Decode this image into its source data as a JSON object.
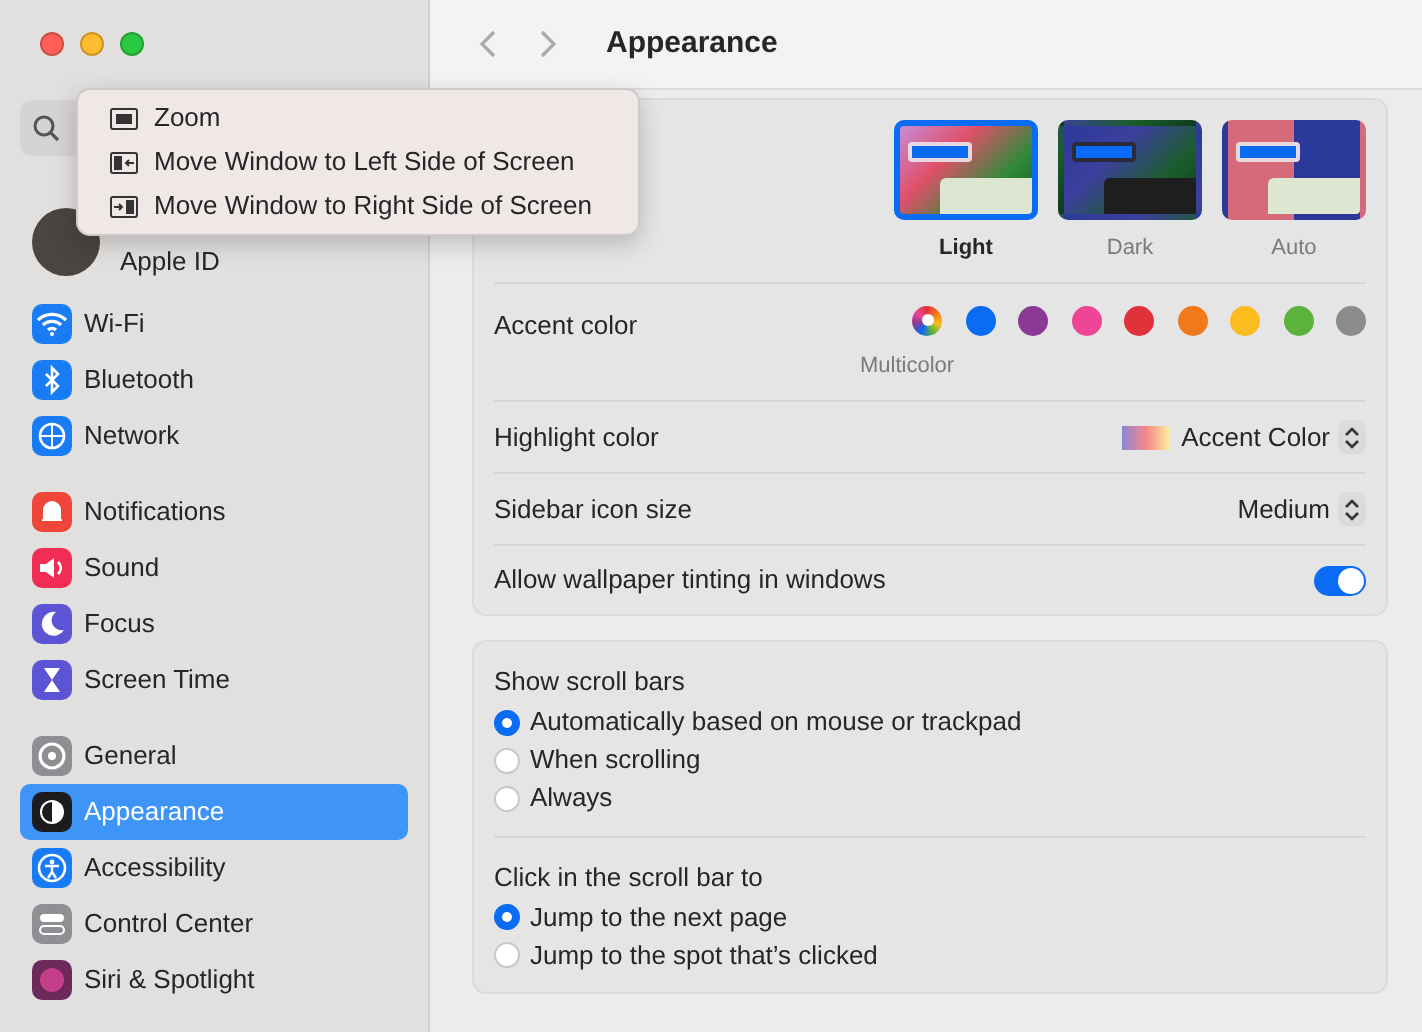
{
  "window_menu": {
    "items": [
      {
        "label": "Zoom",
        "kind": "zoom"
      },
      {
        "label": "Move Window to Left Side of Screen",
        "kind": "left"
      },
      {
        "label": "Move Window to Right Side of Screen",
        "kind": "right"
      }
    ]
  },
  "sidebar": {
    "account": {
      "label": "Apple ID"
    },
    "groups": [
      [
        {
          "label": "Wi-Fi",
          "kind": "wifi",
          "color": "#1a7cf5",
          "selected": false
        },
        {
          "label": "Bluetooth",
          "kind": "bluetooth",
          "color": "#1a7cf5",
          "selected": false
        },
        {
          "label": "Network",
          "kind": "network",
          "color": "#1a7cf5",
          "selected": false
        }
      ],
      [
        {
          "label": "Notifications",
          "kind": "bell",
          "color": "#f0453a",
          "selected": false
        },
        {
          "label": "Sound",
          "kind": "sound",
          "color": "#f22d55",
          "selected": false
        },
        {
          "label": "Focus",
          "kind": "moon",
          "color": "#5b55d6",
          "selected": false
        },
        {
          "label": "Screen Time",
          "kind": "hourglass",
          "color": "#5b55d6",
          "selected": false
        }
      ],
      [
        {
          "label": "General",
          "kind": "gear",
          "color": "#8e8e93",
          "selected": false
        },
        {
          "label": "Appearance",
          "kind": "appearance",
          "color": "#1c1c1e",
          "selected": true
        },
        {
          "label": "Accessibility",
          "kind": "accessibility",
          "color": "#1a7cf5",
          "selected": false
        },
        {
          "label": "Control Center",
          "kind": "switches",
          "color": "#8e8e93",
          "selected": false
        },
        {
          "label": "Siri & Spotlight",
          "kind": "siri",
          "color": "#6b2a5a",
          "selected": false
        }
      ]
    ]
  },
  "toolbar": {
    "title": "Appearance"
  },
  "appearance": {
    "options": [
      {
        "label": "Light",
        "kind": "light",
        "selected": true
      },
      {
        "label": "Dark",
        "kind": "dark",
        "selected": false
      },
      {
        "label": "Auto",
        "kind": "auto",
        "selected": false
      }
    ]
  },
  "accent_color": {
    "label": "Accent color",
    "caption": "Multicolor",
    "swatches": [
      {
        "kind": "multicolor",
        "selected": true
      },
      {
        "kind": "solid",
        "color": "#0a6cf5",
        "selected": false
      },
      {
        "kind": "solid",
        "color": "#8a3a95",
        "selected": false
      },
      {
        "kind": "solid",
        "color": "#ee4596",
        "selected": false
      },
      {
        "kind": "solid",
        "color": "#e0323a",
        "selected": false
      },
      {
        "kind": "solid",
        "color": "#f07a1b",
        "selected": false
      },
      {
        "kind": "solid",
        "color": "#fbbd1d",
        "selected": false
      },
      {
        "kind": "solid",
        "color": "#5cb33b",
        "selected": false
      },
      {
        "kind": "solid",
        "color": "#8c8c8c",
        "selected": false
      }
    ]
  },
  "highlight_color": {
    "label": "Highlight color",
    "value": "Accent Color"
  },
  "sidebar_icon_size": {
    "label": "Sidebar icon size",
    "value": "Medium"
  },
  "wallpaper_tinting": {
    "label": "Allow wallpaper tinting in windows",
    "on": true
  },
  "show_scroll_bars": {
    "label": "Show scroll bars",
    "options": [
      {
        "label": "Automatically based on mouse or trackpad",
        "selected": true
      },
      {
        "label": "When scrolling",
        "selected": false
      },
      {
        "label": "Always",
        "selected": false
      }
    ]
  },
  "click_scroll_bar": {
    "label": "Click in the scroll bar to",
    "options": [
      {
        "label": "Jump to the next page",
        "selected": true
      },
      {
        "label": "Jump to the spot that’s clicked",
        "selected": false
      }
    ]
  }
}
